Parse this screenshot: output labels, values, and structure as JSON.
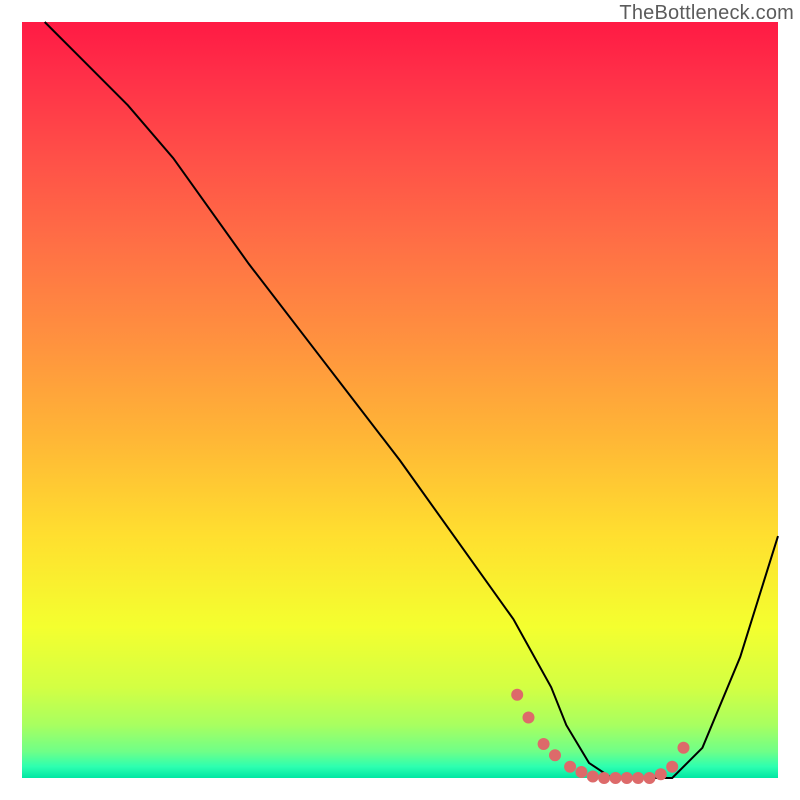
{
  "watermark": "TheBottleneck.com",
  "chart_data": {
    "type": "line",
    "title": "",
    "xlabel": "",
    "ylabel": "",
    "xlim": [
      0,
      100
    ],
    "ylim": [
      0,
      100
    ],
    "grid": false,
    "legend": false,
    "background_gradient": {
      "type": "rainbow_red_to_green",
      "stops": [
        {
          "pos": 0.0,
          "color": "#ff1a44"
        },
        {
          "pos": 0.07,
          "color": "#ff2f48"
        },
        {
          "pos": 0.18,
          "color": "#ff5048"
        },
        {
          "pos": 0.3,
          "color": "#ff7145"
        },
        {
          "pos": 0.42,
          "color": "#ff913f"
        },
        {
          "pos": 0.55,
          "color": "#ffb636"
        },
        {
          "pos": 0.68,
          "color": "#ffdf2f"
        },
        {
          "pos": 0.8,
          "color": "#f4ff2f"
        },
        {
          "pos": 0.88,
          "color": "#d3ff43"
        },
        {
          "pos": 0.93,
          "color": "#a8ff60"
        },
        {
          "pos": 0.965,
          "color": "#6fff88"
        },
        {
          "pos": 0.985,
          "color": "#2dffb0"
        },
        {
          "pos": 1.0,
          "color": "#00e7a3"
        }
      ]
    },
    "series": [
      {
        "name": "bottleneck-curve",
        "color": "#000000",
        "x": [
          3,
          7,
          14,
          20,
          30,
          40,
          50,
          60,
          65,
          70,
          72,
          75,
          78,
          82,
          86,
          90,
          95,
          100
        ],
        "y": [
          100,
          96,
          89,
          82,
          68,
          55,
          42,
          28,
          21,
          12,
          7,
          2,
          0,
          0,
          0,
          4,
          16,
          32
        ],
        "note": "Curve is read approximately from pixels; y=0 means at green floor, y=100 at top."
      }
    ],
    "highlight": {
      "name": "optimal-range-dots",
      "color": "#dd6a6a",
      "x": [
        65.5,
        67,
        69,
        70.5,
        72.5,
        74,
        75.5,
        77,
        78.5,
        80,
        81.5,
        83,
        84.5,
        86,
        87.5
      ],
      "y": [
        11,
        8,
        4.5,
        3,
        1.5,
        0.8,
        0.2,
        0,
        0,
        0,
        0,
        0,
        0.5,
        1.5,
        4
      ]
    }
  }
}
